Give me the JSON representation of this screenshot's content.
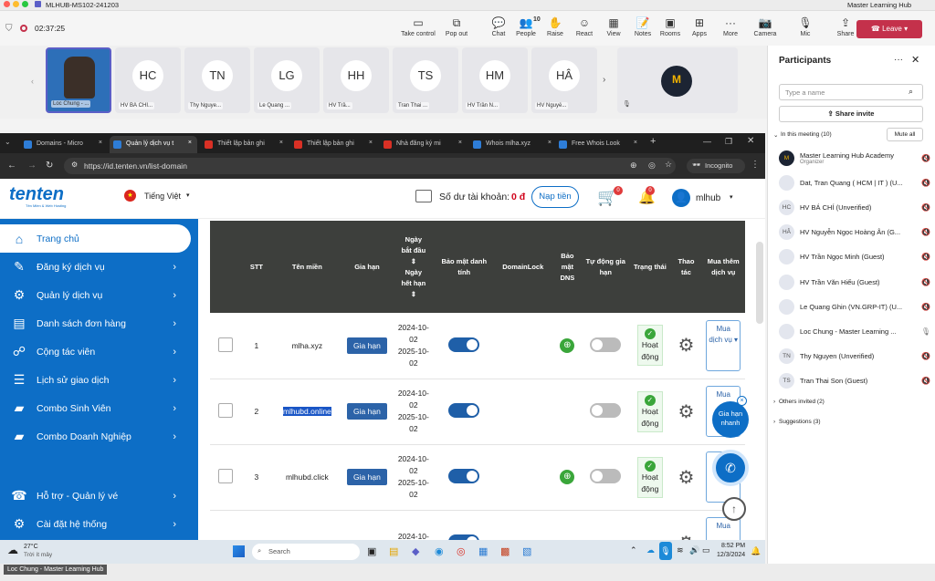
{
  "meeting": {
    "title": "MLHUB-MS102-241203",
    "timer": "02:37:25",
    "organizer_title": "Master Learning Hub",
    "toolbar": [
      {
        "label": "Take control",
        "icon": "take-control-icon"
      },
      {
        "label": "Pop out",
        "icon": "pop-out-icon"
      },
      {
        "label": "Chat",
        "icon": "chat-icon"
      },
      {
        "label": "People",
        "icon": "people-icon",
        "count": "10"
      },
      {
        "label": "Raise",
        "icon": "raise-hand-icon"
      },
      {
        "label": "React",
        "icon": "react-icon"
      },
      {
        "label": "View",
        "icon": "view-icon"
      },
      {
        "label": "Notes",
        "icon": "notes-icon"
      },
      {
        "label": "Rooms",
        "icon": "rooms-icon"
      },
      {
        "label": "Apps",
        "icon": "apps-icon"
      },
      {
        "label": "More",
        "icon": "more-icon"
      },
      {
        "label": "Camera",
        "icon": "camera-icon"
      },
      {
        "label": "Mic",
        "icon": "mic-icon"
      },
      {
        "label": "Share",
        "icon": "share-icon"
      }
    ],
    "leave_label": "Leave",
    "tiles": [
      {
        "initials": "",
        "name": "Loc Chung - ..."
      },
      {
        "initials": "HC",
        "name": "HV BÁ CHÍ..."
      },
      {
        "initials": "TN",
        "name": "Thy Nguye..."
      },
      {
        "initials": "LG",
        "name": "Le Quang ..."
      },
      {
        "initials": "HH",
        "name": "HV Trầ..."
      },
      {
        "initials": "TS",
        "name": "Tran Thai ..."
      },
      {
        "initials": "HM",
        "name": "HV Trần N..."
      },
      {
        "initials": "HÂ",
        "name": "HV Nguyễ..."
      }
    ],
    "bottom_label": "Loc Chung - Master Learning Hub"
  },
  "browser": {
    "tabs": [
      "Domains - Micro",
      "Quản lý dịch vụ t",
      "Thiết lập bản ghi",
      "Thiết lập bản ghi",
      "Nhà đăng ký mi",
      "Whois mlha.xyz",
      "Free Whois Look"
    ],
    "url": "https://id.tenten.vn/list-domain",
    "incognito": "Incognito"
  },
  "site": {
    "brand": "tenten",
    "brand_sub": "Tên Miền & Web Hosting",
    "language": "Tiếng Việt",
    "balance_label": "Số dư tài khoản:",
    "balance_value": "0 đ",
    "topup": "Nạp tiền",
    "cart_count": "0",
    "notif_count": "0",
    "username": "mlhub",
    "nav": [
      {
        "label": "Trang chủ",
        "icon": "home-icon",
        "chev": false
      },
      {
        "label": "Đăng ký dịch vụ",
        "icon": "pencil-icon",
        "chev": true
      },
      {
        "label": "Quản lý dịch vụ",
        "icon": "gear-icon",
        "chev": true
      },
      {
        "label": "Danh sách đơn hàng",
        "icon": "orders-icon",
        "chev": true
      },
      {
        "label": "Cộng tác viên",
        "icon": "handshake-icon",
        "chev": true
      },
      {
        "label": "Lịch sử giao dịch",
        "icon": "history-icon",
        "chev": true
      },
      {
        "label": "Combo Sinh Viên",
        "icon": "folder-icon",
        "chev": true
      },
      {
        "label": "Combo Doanh Nghiệp",
        "icon": "folder-icon",
        "chev": true
      },
      {
        "label": "Hỗ trợ - Quản lý vé",
        "icon": "support-icon",
        "chev": true
      },
      {
        "label": "Cài đặt hệ thống",
        "icon": "settings-icon",
        "chev": true
      }
    ],
    "table": {
      "headers": [
        "STT",
        "Tên miền",
        "Gia hạn",
        "Ngày bắt đầu",
        "Ngày hết hạn",
        "Bảo mật danh tính",
        "DomainLock",
        "Bảo mật DNS",
        "Tự động gia hạn",
        "Trạng thái",
        "Thao tác",
        "Mua thêm dịch vụ"
      ],
      "rows": [
        {
          "stt": "1",
          "domain": "mlha.xyz",
          "renew": "Gia hạn",
          "start": "2024-10-02",
          "end": "2025-10-02",
          "status": "Hoạt động",
          "buy": "Mua dịch vụ ▾"
        },
        {
          "stt": "2",
          "domain": "mlhubd.online",
          "renew": "Gia hạn",
          "start": "2024-10-02",
          "end": "2025-10-02",
          "status": "Hoạt động",
          "buy": "Mua"
        },
        {
          "stt": "3",
          "domain": "mlhubd.click",
          "renew": "Gia hạn",
          "start": "2024-10-02",
          "end": "2025-10-02",
          "status": "Hoạt động",
          "buy": "vụ ▾"
        },
        {
          "stt": "",
          "domain": "",
          "renew": "",
          "start": "2024-10-02",
          "end": "",
          "status": "",
          "buy": "Mua"
        }
      ]
    },
    "quick_renew": "Gia hạn nhanh"
  },
  "taskbar": {
    "weather_temp": "27°C",
    "weather_desc": "Trời ít mây",
    "search": "Search",
    "time": "8:52 PM",
    "date": "12/3/2024"
  },
  "participants": {
    "title": "Participants",
    "search_placeholder": "Type a name",
    "share_invite": "Share invite",
    "in_meeting": "In this meeting (10)",
    "mute_all": "Mute all",
    "list": [
      {
        "initials": "M",
        "name": "Master Learning Hub Academy",
        "sub": "Organizer"
      },
      {
        "initials": "",
        "name": "Dat, Tran Quang ( HCM | IT ) (U..."
      },
      {
        "initials": "HC",
        "name": "HV BÁ CHÍ (Unverified)"
      },
      {
        "initials": "HÂ",
        "name": "HV Nguyễn Ngọc Hoàng Ân (G..."
      },
      {
        "initials": "",
        "name": "HV Trần Ngọc Minh (Guest)"
      },
      {
        "initials": "",
        "name": "HV Trần Văn Hiếu (Guest)"
      },
      {
        "initials": "",
        "name": "Le Quang Ghin (VN.GRP-IT) (U..."
      },
      {
        "initials": "",
        "name": "Loc Chung - Master Learning ..."
      },
      {
        "initials": "TN",
        "name": "Thy Nguyen (Unverified)"
      },
      {
        "initials": "TS",
        "name": "Tran Thai Son (Guest)"
      }
    ],
    "others_invited": "Others invited (2)",
    "suggestions": "Suggestions (3)"
  },
  "colors": {
    "leave": "#c4314b",
    "brand_blue": "#0d6ec6",
    "table_header": "#3d3f3c"
  }
}
